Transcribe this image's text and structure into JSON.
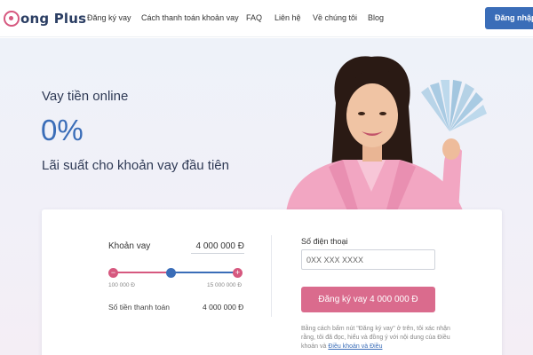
{
  "header": {
    "logo": {
      "text": "ong Plus",
      "icon": "logo-d-mark"
    },
    "nav": [
      {
        "label": "Đăng ký vay"
      },
      {
        "label": "Cách thanh toán khoản vay"
      },
      {
        "label": "FAQ"
      },
      {
        "label": "Liên hệ"
      },
      {
        "label": "Về chúng tôi"
      },
      {
        "label": "Blog"
      }
    ],
    "login_label": "Đăng nhập"
  },
  "hero": {
    "small_title": "Vay tiền online",
    "big_value": "0%",
    "subtitle": "Lãi suất cho khoản vay đầu tiên"
  },
  "calculator": {
    "loan_label": "Khoản vay",
    "loan_amount": "4 000 000 Đ",
    "slider": {
      "min_label": "100 000 Đ",
      "max_label": "15 000 000 Đ",
      "minus_icon": "minus-icon",
      "plus_icon": "plus-icon"
    },
    "payment_label": "Số tiền thanh toán",
    "payment_value": "4 000 000 Đ"
  },
  "application": {
    "phone_label": "Số điện thoại",
    "phone_placeholder": "0XX XXX XXXX",
    "submit_label": "Đăng ký vay 4 000 000 Đ",
    "legal_text": "Bằng cách bấm nút \"Đăng ký vay\" ở trên, tôi xác nhận rằng, tôi đã đọc, hiểu và đồng ý với nội dung của Điều khoản và",
    "legal_link": "Điều khoản và Điều"
  },
  "colors": {
    "brand_blue": "#3a6db8",
    "brand_pink": "#d6587f",
    "button_pink": "#da6b8d",
    "navy": "#2b3e63"
  }
}
